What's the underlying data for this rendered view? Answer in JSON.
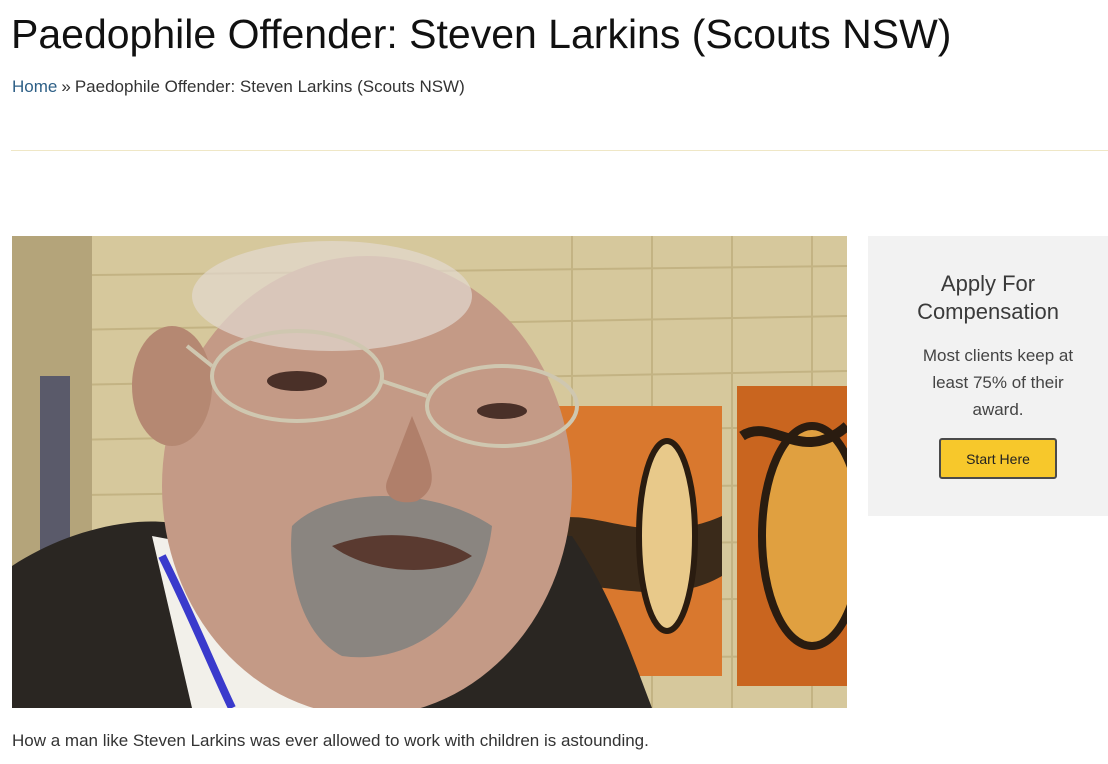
{
  "page": {
    "title": "Paedophile Offender: Steven Larkins (Scouts NSW)"
  },
  "breadcrumb": {
    "home": "Home",
    "separator": "»",
    "current": "Paedophile Offender: Steven Larkins (Scouts NSW)"
  },
  "article": {
    "caption": "How a man like Steven Larkins was ever allowed to work with children is astounding."
  },
  "sidebar": {
    "title_line1": "Apply For",
    "title_line2": "Compensation",
    "text": "Most clients keep at least 75% of their award.",
    "button_label": "Start Here"
  },
  "colors": {
    "link": "#2d5f86",
    "button": "#f7c82b",
    "sidebar_bg": "#f2f2f2",
    "divider": "#efe7c6"
  }
}
